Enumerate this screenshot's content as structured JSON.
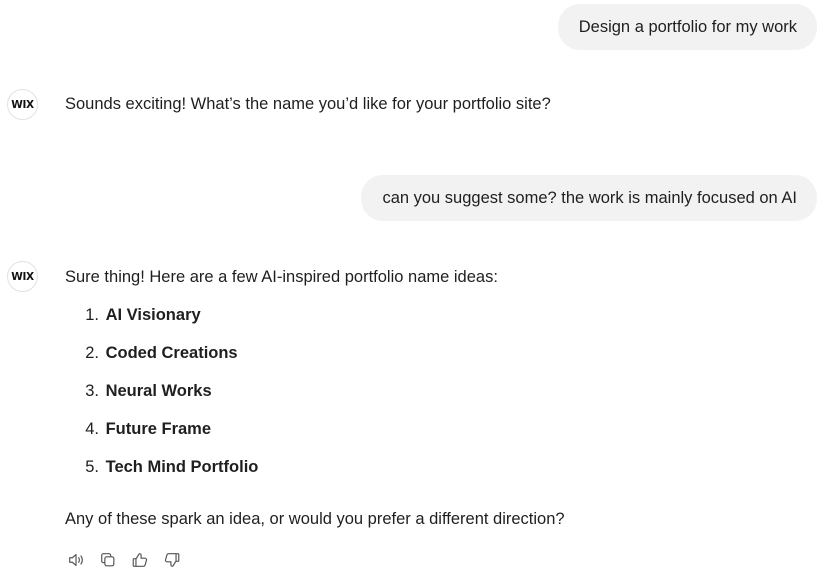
{
  "conversation": {
    "user_messages": [
      "Design a portfolio for my work",
      "can you suggest some? the work is mainly focused on AI"
    ],
    "assistant": {
      "avatar_label": "WIX",
      "first_reply": "Sounds exciting! What’s the name you’d like for your portfolio site?",
      "second_reply_intro": "Sure thing! Here are a few AI-inspired portfolio name ideas:",
      "ideas": [
        {
          "number": "1.",
          "name": "AI Visionary"
        },
        {
          "number": "2.",
          "name": "Coded Creations"
        },
        {
          "number": "3.",
          "name": "Neural Works"
        },
        {
          "number": "4.",
          "name": "Future Frame"
        },
        {
          "number": "5.",
          "name": "Tech Mind Portfolio"
        }
      ],
      "closing": "Any of these spark an idea, or would you prefer a different direction?"
    }
  },
  "actions": {
    "icons": [
      "speaker-icon",
      "copy-icon",
      "thumbs-up-icon",
      "thumbs-down-icon"
    ]
  },
  "colors": {
    "user_bubble": "#f2f2f2",
    "text": "#1f1f1f",
    "icon": "#555555"
  }
}
